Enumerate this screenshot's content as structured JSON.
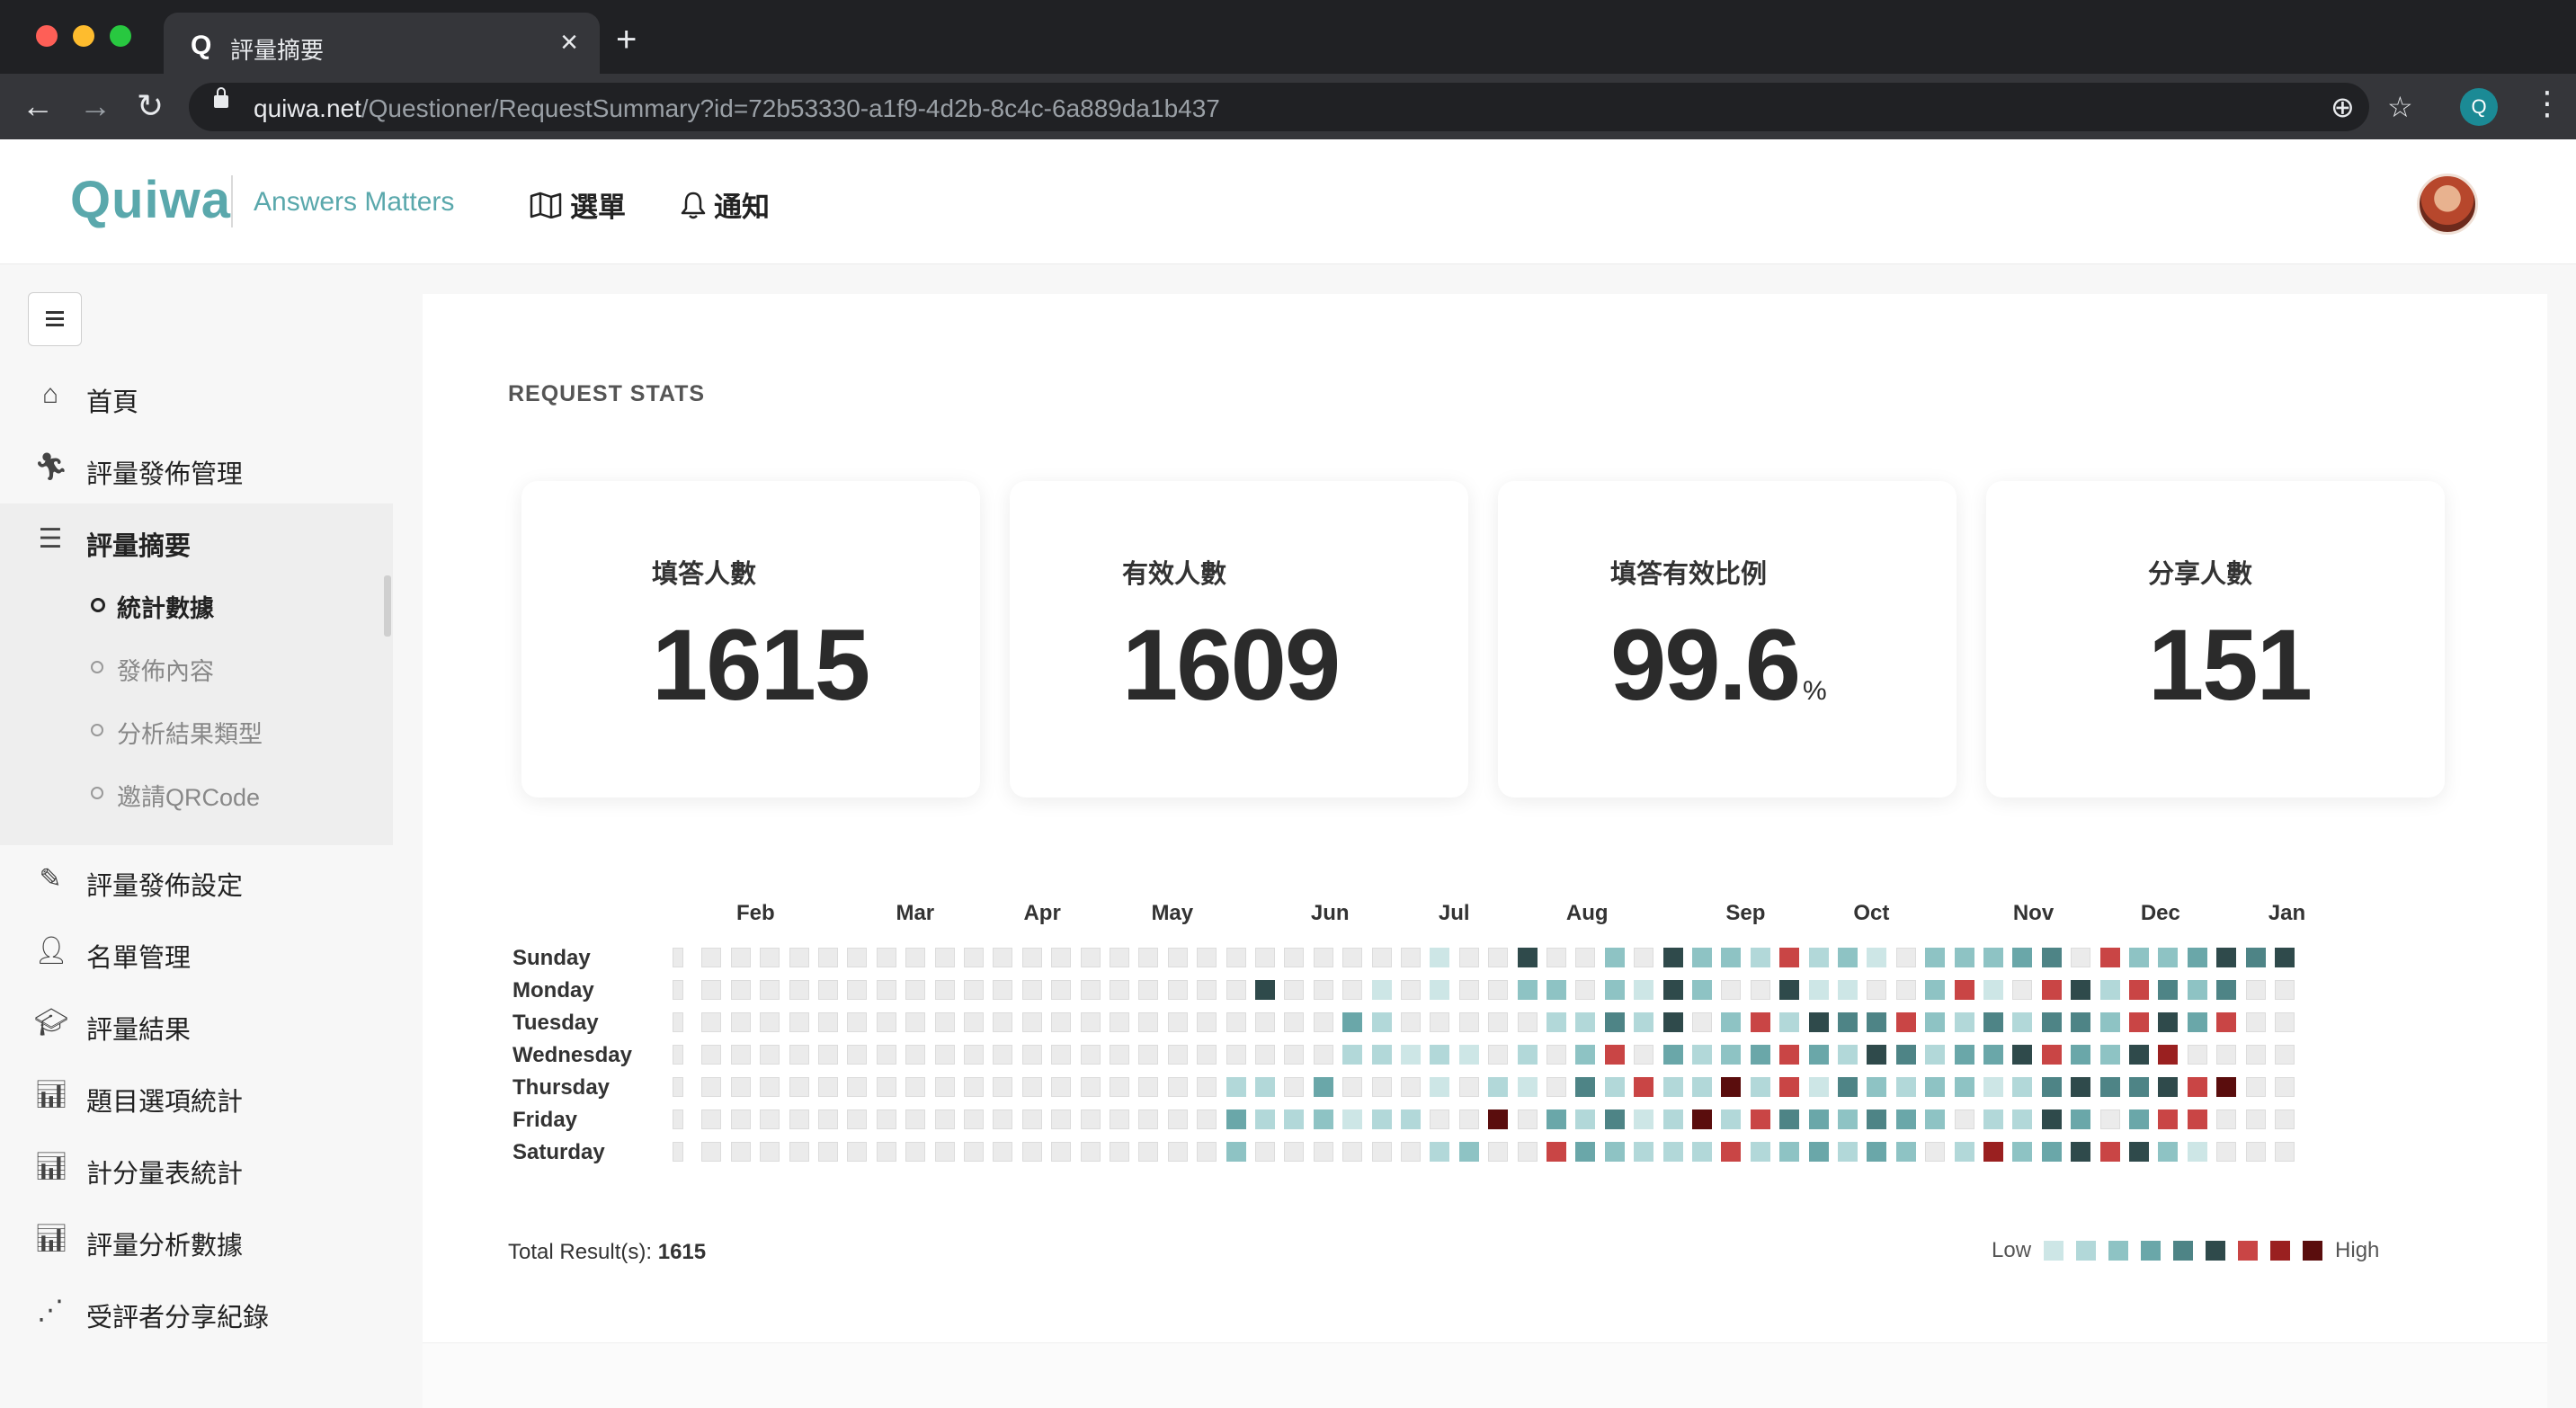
{
  "browser": {
    "tab_title": "評量摘要",
    "tab_favicon": "Q",
    "tab_close": "×",
    "new_tab": "+",
    "url_host": "quiwa.net",
    "url_path": "/Questioner/RequestSummary?id=72b53330-a1f9-4d2b-8c4c-6a889da1b437",
    "profile_initial": "Q",
    "icons": [
      "back-icon",
      "forward-icon",
      "reload-icon",
      "lock-icon",
      "add-icon",
      "star-icon",
      "more-icon"
    ]
  },
  "header": {
    "logo": "Quiwa",
    "tagline": "Answers Matters",
    "nav": [
      {
        "label": "選單",
        "icon": "map-icon"
      },
      {
        "label": "通知",
        "icon": "bell-icon"
      }
    ]
  },
  "sidebar": {
    "items": [
      {
        "label": "首頁",
        "icon": "home-icon"
      },
      {
        "label": "評量發佈管理",
        "icon": "runner-icon"
      },
      {
        "label": "評量摘要",
        "icon": "list-icon"
      },
      {
        "label": "評量發佈設定",
        "icon": "edit-icon"
      },
      {
        "label": "名單管理",
        "icon": "user-icon"
      },
      {
        "label": "評量結果",
        "icon": "graduation-icon"
      },
      {
        "label": "題目選項統計",
        "icon": "bar-chart-icon"
      },
      {
        "label": "計分量表統計",
        "icon": "bar-chart-icon"
      },
      {
        "label": "評量分析數據",
        "icon": "bar-chart-icon"
      },
      {
        "label": "受評者分享紀錄",
        "icon": "share-icon"
      }
    ],
    "subitems": [
      {
        "label": "統計數據",
        "active": true
      },
      {
        "label": "發佈內容",
        "active": false
      },
      {
        "label": "分析結果類型",
        "active": false
      },
      {
        "label": "邀請QRCode",
        "active": false
      }
    ]
  },
  "main": {
    "section_title": "REQUEST STATS",
    "stats": [
      {
        "label": "填答人數",
        "value": "1615",
        "unit": ""
      },
      {
        "label": "有效人數",
        "value": "1609",
        "unit": ""
      },
      {
        "label": "填答有效比例",
        "value": "99.6",
        "unit": "%"
      },
      {
        "label": "分享人數",
        "value": "151",
        "unit": ""
      }
    ],
    "total_label": "Total Result(s):",
    "total_value": "1615",
    "legend_low": "Low",
    "legend_high": "High"
  },
  "chart_data": {
    "type": "heatmap",
    "title": "",
    "months": [
      {
        "label": "Feb",
        "week": 2
      },
      {
        "label": "Mar",
        "week": 7
      },
      {
        "label": "Apr",
        "week": 11
      },
      {
        "label": "May",
        "week": 15
      },
      {
        "label": "Jun",
        "week": 20
      },
      {
        "label": "Jul",
        "week": 24
      },
      {
        "label": "Aug",
        "week": 28
      },
      {
        "label": "Sep",
        "week": 33
      },
      {
        "label": "Oct",
        "week": 37
      },
      {
        "label": "Nov",
        "week": 42
      },
      {
        "label": "Dec",
        "week": 46
      },
      {
        "label": "Jan",
        "week": 50
      }
    ],
    "days": [
      "Sunday",
      "Monday",
      "Tuesday",
      "Wednesday",
      "Thursday",
      "Friday",
      "Saturday"
    ],
    "levels": [
      "000000000000000000000000000100031041430122131101010111101010100101010101010101010101010101010101010101",
      "000000000000000000000000000000000000000000000600100100000111061500606110030016007060106061010010100100",
      "000000000000000000000000000000000000000000000000000000000000000000000000000000000000000000000000000000",
      "000000000000000000000000000000000000000000000000000000000000000000000000000000000000000000000000000000",
      "000000000000000000000000000000000000000000000000000000000000000000000000000000000000000000000000000000",
      "000000000000000000000000000000000000000000000000000000000000000000000000000000000000000000000000000000",
      "000000000000000000000000000000000000000000000000000000000000000000000000000000000000000000000000000000"
    ],
    "grid": [
      [
        0,
        0,
        0,
        0,
        0,
        0,
        0,
        0,
        0,
        0,
        0,
        0,
        0,
        0,
        0,
        0,
        0,
        0,
        0,
        0,
        0,
        0,
        0,
        0,
        0,
        0,
        1,
        0,
        0,
        6,
        0,
        0,
        3,
        0,
        6,
        3,
        3,
        2,
        7,
        2,
        3,
        1,
        0,
        3,
        3,
        3,
        4,
        5,
        0,
        7,
        3,
        3,
        4,
        6,
        5,
        6,
        6
      ],
      [
        0,
        0,
        0,
        0,
        0,
        0,
        0,
        0,
        0,
        0,
        0,
        0,
        0,
        0,
        0,
        0,
        0,
        0,
        0,
        0,
        6,
        0,
        0,
        0,
        1,
        0,
        1,
        0,
        0,
        3,
        3,
        0,
        3,
        1,
        6,
        3,
        0,
        0,
        6,
        1,
        1,
        0,
        0,
        3,
        7,
        1,
        0,
        7,
        6,
        2,
        7,
        5,
        3,
        5
      ],
      [
        0,
        0,
        0,
        0,
        0,
        0,
        0,
        0,
        0,
        0,
        0,
        0,
        0,
        0,
        0,
        0,
        0,
        0,
        0,
        0,
        0,
        0,
        0,
        4,
        2,
        0,
        0,
        0,
        0,
        0,
        2,
        2,
        5,
        2,
        6,
        0,
        3,
        7,
        2,
        6,
        5,
        5,
        7,
        3,
        2,
        5,
        2,
        5,
        5,
        3,
        7,
        6,
        4,
        7
      ],
      [
        0,
        0,
        0,
        0,
        0,
        0,
        0,
        0,
        0,
        0,
        0,
        0,
        0,
        0,
        0,
        0,
        0,
        0,
        0,
        0,
        0,
        0,
        0,
        2,
        2,
        1,
        2,
        1,
        0,
        2,
        0,
        3,
        7,
        0,
        4,
        2,
        3,
        4,
        7,
        4,
        2,
        6,
        5,
        2,
        4,
        4,
        6,
        7,
        4,
        3,
        6,
        8
      ],
      [
        0,
        0,
        0,
        0,
        0,
        0,
        0,
        0,
        0,
        0,
        0,
        0,
        0,
        0,
        0,
        0,
        0,
        0,
        0,
        2,
        2,
        0,
        4,
        0,
        0,
        0,
        1,
        0,
        2,
        1,
        0,
        5,
        2,
        7,
        2,
        2,
        9,
        2,
        7,
        1,
        5,
        3,
        2,
        3,
        3,
        1,
        2,
        5,
        6,
        5,
        5,
        6,
        7,
        9
      ],
      [
        0,
        0,
        0,
        0,
        0,
        0,
        0,
        0,
        0,
        0,
        0,
        0,
        0,
        0,
        0,
        0,
        0,
        0,
        0,
        4,
        2,
        2,
        3,
        1,
        2,
        2,
        0,
        0,
        9,
        0,
        4,
        2,
        5,
        1,
        2,
        9,
        2,
        7,
        5,
        4,
        3,
        5,
        4,
        3,
        0,
        2,
        2,
        6,
        4,
        0,
        4,
        7,
        7
      ],
      [
        0,
        0,
        0,
        0,
        0,
        0,
        0,
        0,
        0,
        0,
        0,
        0,
        0,
        0,
        0,
        0,
        0,
        0,
        0,
        3,
        0,
        0,
        0,
        0,
        0,
        0,
        2,
        3,
        0,
        0,
        7,
        4,
        3,
        2,
        2,
        2,
        7,
        2,
        3,
        4,
        2,
        4,
        3,
        0,
        2,
        8,
        3,
        4,
        6,
        7,
        6,
        3,
        1
      ]
    ],
    "weeks": 55,
    "scale": [
      "#e4e4e4",
      "#c7e4e4",
      "#a9d4d4",
      "#8fc4c6",
      "#6ea9ab",
      "#4e7f80",
      "#2f4a4b",
      "#c94545",
      "#9a2222",
      "#6b1212",
      "#3a0808"
    ]
  }
}
